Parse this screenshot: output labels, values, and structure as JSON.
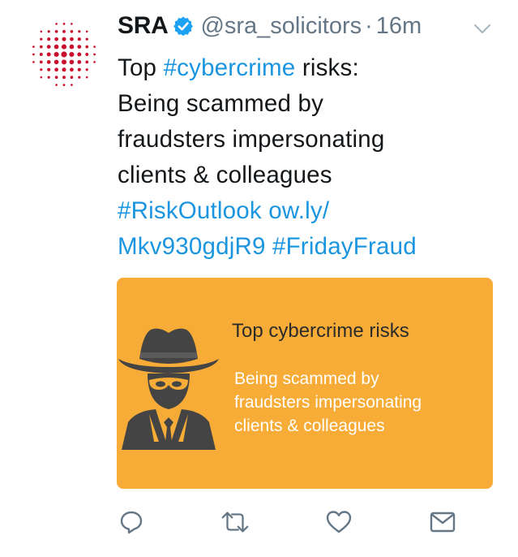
{
  "tweet": {
    "author_name": "SRA",
    "handle": "@sra_solicitors",
    "separator": "·",
    "time": "16m",
    "text": {
      "line1_prefix": "Top ",
      "line1_hashtag": "#cybercrime",
      "line1_suffix": " risks:",
      "line2": "Being scammed by",
      "line3": "fraudsters impersonating",
      "line4": "clients & colleagues",
      "line5_hashtag": "#RiskOutlook",
      "line5_link": "ow.ly/",
      "line6_link": "Mkv930gdjR9",
      "line6_hashtag": "#FridayFraud"
    }
  },
  "card": {
    "title": "Top cybercrime risks",
    "sub_line1": "Being scammed by",
    "sub_line2": "fraudsters impersonating",
    "sub_line3": "clients & colleagues"
  },
  "icons": {
    "avatar": "sra-logo-dots",
    "verified": "verified-badge-icon",
    "caret": "chevron-down-icon",
    "reply": "reply-icon",
    "retweet": "retweet-icon",
    "like": "heart-icon",
    "dm": "envelope-icon",
    "card_figure": "spy-figure-icon"
  },
  "colors": {
    "link": "#1b95e0",
    "card_background": "#f7ac37",
    "logo": "#c8102e",
    "secondary_text": "#657786"
  }
}
